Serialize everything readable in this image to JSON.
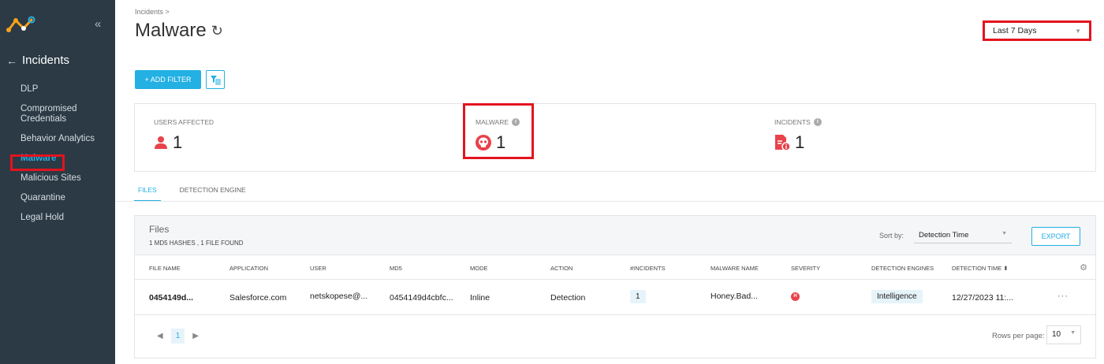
{
  "sidebar": {
    "collapse_icon": "«",
    "section_back": "←",
    "section_title": "Incidents",
    "items": [
      {
        "label": "DLP"
      },
      {
        "label": "Compromised Credentials"
      },
      {
        "label": "Behavior Analytics"
      },
      {
        "label": "Malware"
      },
      {
        "label": "Malicious Sites"
      },
      {
        "label": "Quarantine"
      },
      {
        "label": "Legal Hold"
      }
    ],
    "active_index": 3
  },
  "header": {
    "breadcrumb": "Incidents >",
    "title": "Malware",
    "refresh_icon": "↻",
    "date_range": "Last 7 Days",
    "caret": "▼"
  },
  "toolbar": {
    "add_filter_label": "+ ADD FILTER"
  },
  "stats": {
    "users_affected": {
      "label": "USERS AFFECTED",
      "value": "1"
    },
    "malware": {
      "label": "MALWARE",
      "value": "1"
    },
    "incidents": {
      "label": "INCIDENTS",
      "value": "1"
    },
    "info_glyph": "i"
  },
  "tabs": [
    {
      "label": "FILES",
      "active": true
    },
    {
      "label": "DETECTION ENGINE",
      "active": false
    }
  ],
  "files": {
    "title": "Files",
    "subtitle": "1 MD5 HASHES , 1 FILE FOUND",
    "sort_label": "Sort by:",
    "sort_value": "Detection Time",
    "export_label": "EXPORT",
    "columns": [
      "FILE NAME",
      "APPLICATION",
      "USER",
      "MD5",
      "MODE",
      "ACTION",
      "#INCIDENTS",
      "MALWARE NAME",
      "SEVERITY",
      "DETECTION ENGINES",
      "DETECTION TIME ⬍"
    ],
    "rows": [
      {
        "file_name": "0454149d...",
        "application": "Salesforce.com",
        "user": "netskopese@...",
        "md5": "0454149d4cbfc...",
        "mode": "Inline",
        "action": "Detection",
        "incidents": "1",
        "malware_name": "Honey.Bad...",
        "severity": "H",
        "detection_engines": "Intelligence",
        "detection_time": "12/27/2023 11:...",
        "more": "···"
      }
    ],
    "page": "1",
    "prev": "◀",
    "next": "▶",
    "rows_per_page_label": "Rows per page:",
    "rows_per_page": "10",
    "gear_icon": "⚙"
  },
  "colors": {
    "accent": "#23b0e3",
    "alert": "#e8424a",
    "highlight": "#e3141e",
    "sidebar_bg": "#2b3a45"
  }
}
